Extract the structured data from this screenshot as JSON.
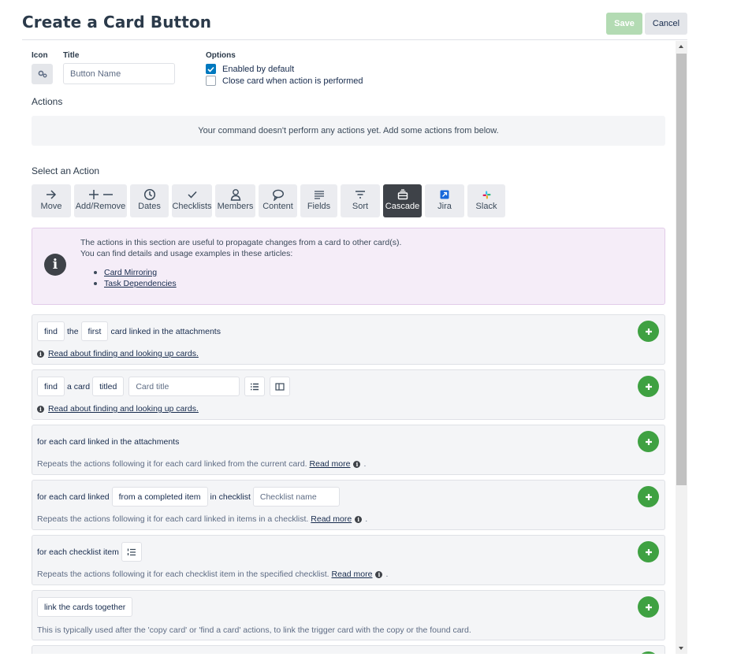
{
  "header": {
    "title": "Create a Card Button",
    "save_label": "Save",
    "cancel_label": "Cancel"
  },
  "form": {
    "icon_label": "Icon",
    "icon_name": "gears-icon",
    "title_label": "Title",
    "title_placeholder": "Button Name",
    "title_value": "",
    "options_label": "Options",
    "options": [
      {
        "label": "Enabled by default",
        "checked": true
      },
      {
        "label": "Close card when action is performed",
        "checked": false
      }
    ]
  },
  "actions": {
    "label": "Actions",
    "empty_message": "Your command doesn't perform any actions yet. Add some actions from below."
  },
  "select_action": {
    "label": "Select an Action",
    "tabs": [
      {
        "label": "Move",
        "icon": "arrow-right-icon"
      },
      {
        "label": "Add/Remove",
        "icon": "plus-minus-icon"
      },
      {
        "label": "Dates",
        "icon": "clock-icon"
      },
      {
        "label": "Checklists",
        "icon": "check-icon"
      },
      {
        "label": "Members",
        "icon": "person-icon"
      },
      {
        "label": "Content",
        "icon": "speech-bubble-icon"
      },
      {
        "label": "Fields",
        "icon": "lines-icon"
      },
      {
        "label": "Sort",
        "icon": "sort-icon"
      },
      {
        "label": "Cascade",
        "icon": "cascade-icon",
        "active": true
      },
      {
        "label": "Jira",
        "icon": "jira-icon"
      },
      {
        "label": "Slack",
        "icon": "slack-icon"
      }
    ]
  },
  "info": {
    "line1": "The actions in this section are useful to propagate changes from a card to other card(s).",
    "line2": "You can find details and usage examples in these articles:",
    "links": [
      "Card Mirroring",
      "Task Dependencies"
    ]
  },
  "cards": {
    "c1": {
      "find": "find",
      "the": "the",
      "first": "first",
      "rest": "card linked in the attachments",
      "link": "Read about finding and looking up cards."
    },
    "c2": {
      "find": "find",
      "a_card": "a card",
      "titled": "titled",
      "placeholder": "Card title",
      "link": "Read about finding and looking up cards."
    },
    "c3": {
      "text": "for each card linked in the attachments",
      "desc": "Repeats the actions following it for each card linked from the current card.",
      "more": "Read more",
      "end": "."
    },
    "c4": {
      "pre": "for each card linked",
      "chip": "from a completed item",
      "mid": "in checklist",
      "placeholder": "Checklist name",
      "desc": "Repeats the actions following it for each card linked in items in a checklist.",
      "more": "Read more",
      "end": "."
    },
    "c5": {
      "text": "for each checklist item",
      "desc": "Repeats the actions following it for each checklist item in the specified checklist.",
      "more": "Read more",
      "end": "."
    },
    "c6": {
      "chip": "link the cards together",
      "desc": "This is typically used after the 'copy card' or 'find a card' actions, to link the trigger card with the copy or the found card."
    }
  },
  "colors": {
    "save_disabled": "#b3dbb3",
    "add_green": "#3fa142",
    "info_bg": "#f5edf8",
    "active_tab": "#3e4248",
    "checkbox_blue": "#0079bf"
  }
}
